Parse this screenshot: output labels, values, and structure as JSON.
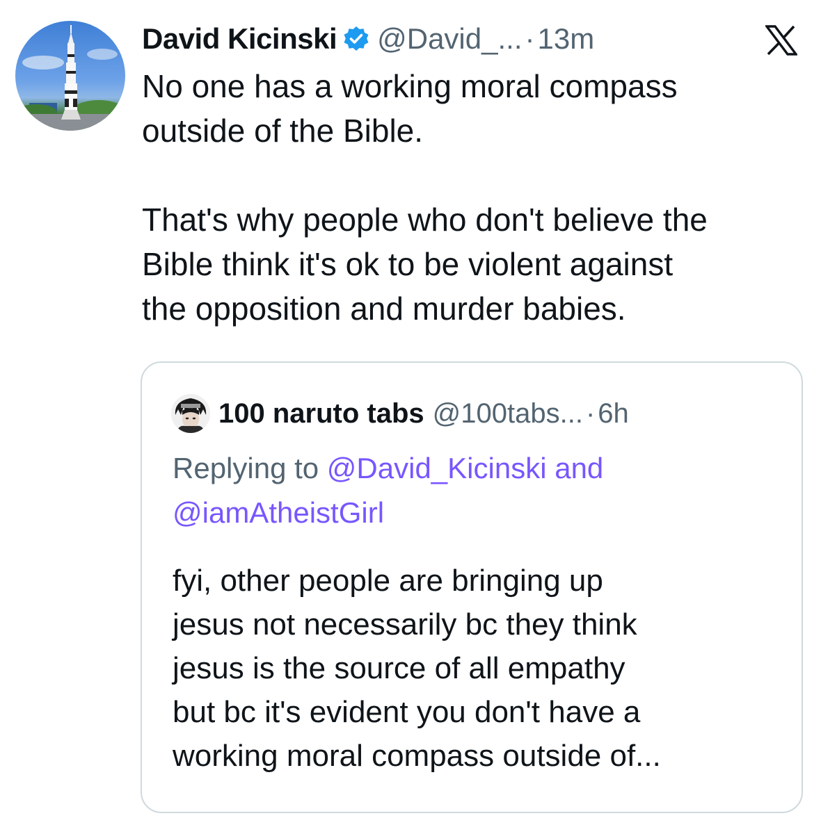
{
  "tweet": {
    "author_name": "David Kicinski",
    "verified": true,
    "handle": "@David_...",
    "separator": "·",
    "time": "13m",
    "text": "No one has a working moral compass\noutside of the Bible.\n\nThat's why people who don't believe the\nBible think it's ok to be violent against\nthe opposition and murder babies.",
    "avatar_icon": "rocket-photo-avatar",
    "logo_icon": "x-logo-icon"
  },
  "quoted_tweet": {
    "author_name": "100 naruto tabs",
    "handle": "@100tabs...",
    "separator": "·",
    "time": "6h",
    "replying_prefix": "Replying to ",
    "reply_mention_1": "@David_Kicinski",
    "reply_conjunction": " and ",
    "reply_mention_2": "@iamAtheistGirl",
    "text": "fyi, other people are bringing up\njesus not necessarily bc they think\njesus is the source of all empathy\nbut bc it's evident you don't have a\nworking moral compass outside of...",
    "avatar_icon": "anime-character-avatar"
  },
  "colors": {
    "text_primary": "#0f1419",
    "text_secondary": "#536471",
    "mention": "#7856ff",
    "verified_badge": "#1d9bf0",
    "border": "#cfd9de"
  }
}
